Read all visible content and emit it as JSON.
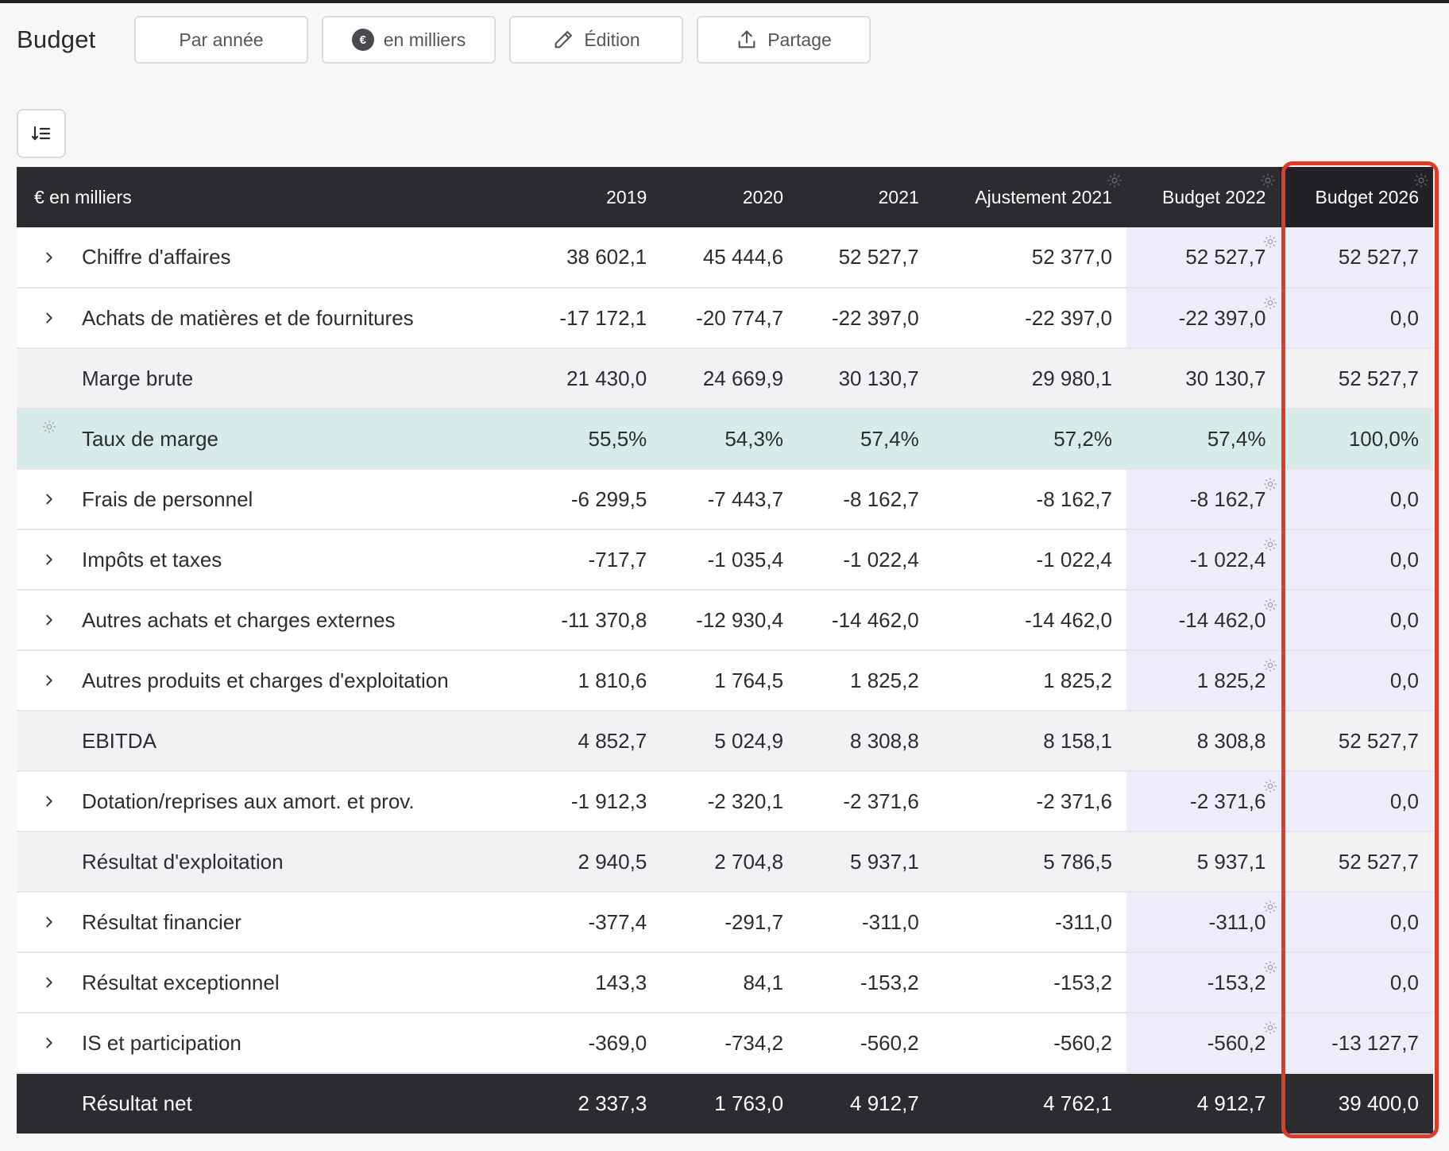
{
  "app": {
    "title": "Budget"
  },
  "toolbar": {
    "par_annee": "Par année",
    "en_milliers": "en milliers",
    "edition": "Édition",
    "partage": "Partage"
  },
  "table": {
    "columns": [
      "€ en milliers",
      "2019",
      "2020",
      "2021",
      "Ajustement 2021",
      "Budget 2022",
      "Budget 2026"
    ],
    "rows": [
      {
        "label": "Chiffre d'affaires",
        "values": [
          "38 602,1",
          "45 444,6",
          "52 527,7",
          "52 377,0",
          "52 527,7",
          "52 527,7"
        ]
      },
      {
        "label": "Achats de matières et de fournitures",
        "values": [
          "-17 172,1",
          "-20 774,7",
          "-22 397,0",
          "-22 397,0",
          "-22 397,0",
          "0,0"
        ]
      },
      {
        "label": "Marge brute",
        "values": [
          "21 430,0",
          "24 669,9",
          "30 130,7",
          "29 980,1",
          "30 130,7",
          "52 527,7"
        ]
      },
      {
        "label": "Taux de marge",
        "values": [
          "55,5%",
          "54,3%",
          "57,4%",
          "57,2%",
          "57,4%",
          "100,0%"
        ]
      },
      {
        "label": "Frais de personnel",
        "values": [
          "-6 299,5",
          "-7 443,7",
          "-8 162,7",
          "-8 162,7",
          "-8 162,7",
          "0,0"
        ]
      },
      {
        "label": "Impôts et taxes",
        "values": [
          "-717,7",
          "-1 035,4",
          "-1 022,4",
          "-1 022,4",
          "-1 022,4",
          "0,0"
        ]
      },
      {
        "label": "Autres achats et charges externes",
        "values": [
          "-11 370,8",
          "-12 930,4",
          "-14 462,0",
          "-14 462,0",
          "-14 462,0",
          "0,0"
        ]
      },
      {
        "label": "Autres produits et charges d'exploitation",
        "values": [
          "1 810,6",
          "1 764,5",
          "1 825,2",
          "1 825,2",
          "1 825,2",
          "0,0"
        ]
      },
      {
        "label": "EBITDA",
        "values": [
          "4 852,7",
          "5 024,9",
          "8 308,8",
          "8 158,1",
          "8 308,8",
          "52 527,7"
        ]
      },
      {
        "label": "Dotation/reprises aux amort. et prov.",
        "values": [
          "-1 912,3",
          "-2 320,1",
          "-2 371,6",
          "-2 371,6",
          "-2 371,6",
          "0,0"
        ]
      },
      {
        "label": "Résultat d'exploitation",
        "values": [
          "2 940,5",
          "2 704,8",
          "5 937,1",
          "5 786,5",
          "5 937,1",
          "52 527,7"
        ]
      },
      {
        "label": "Résultat financier",
        "values": [
          "-377,4",
          "-291,7",
          "-311,0",
          "-311,0",
          "-311,0",
          "0,0"
        ]
      },
      {
        "label": "Résultat exceptionnel",
        "values": [
          "143,3",
          "84,1",
          "-153,2",
          "-153,2",
          "-153,2",
          "0,0"
        ]
      },
      {
        "label": "IS et participation",
        "values": [
          "-369,0",
          "-734,2",
          "-560,2",
          "-560,2",
          "-560,2",
          "-13 127,7"
        ]
      },
      {
        "label": "Résultat net",
        "values": [
          "2 337,3",
          "1 763,0",
          "4 912,7",
          "4 762,1",
          "4 912,7",
          "39 400,0"
        ]
      }
    ]
  },
  "colors": {
    "header_bg": "#2c2c30",
    "highlight": "#e33a28",
    "rate_bg": "#d6ebea",
    "budget_col_bg": "#ececfb"
  }
}
